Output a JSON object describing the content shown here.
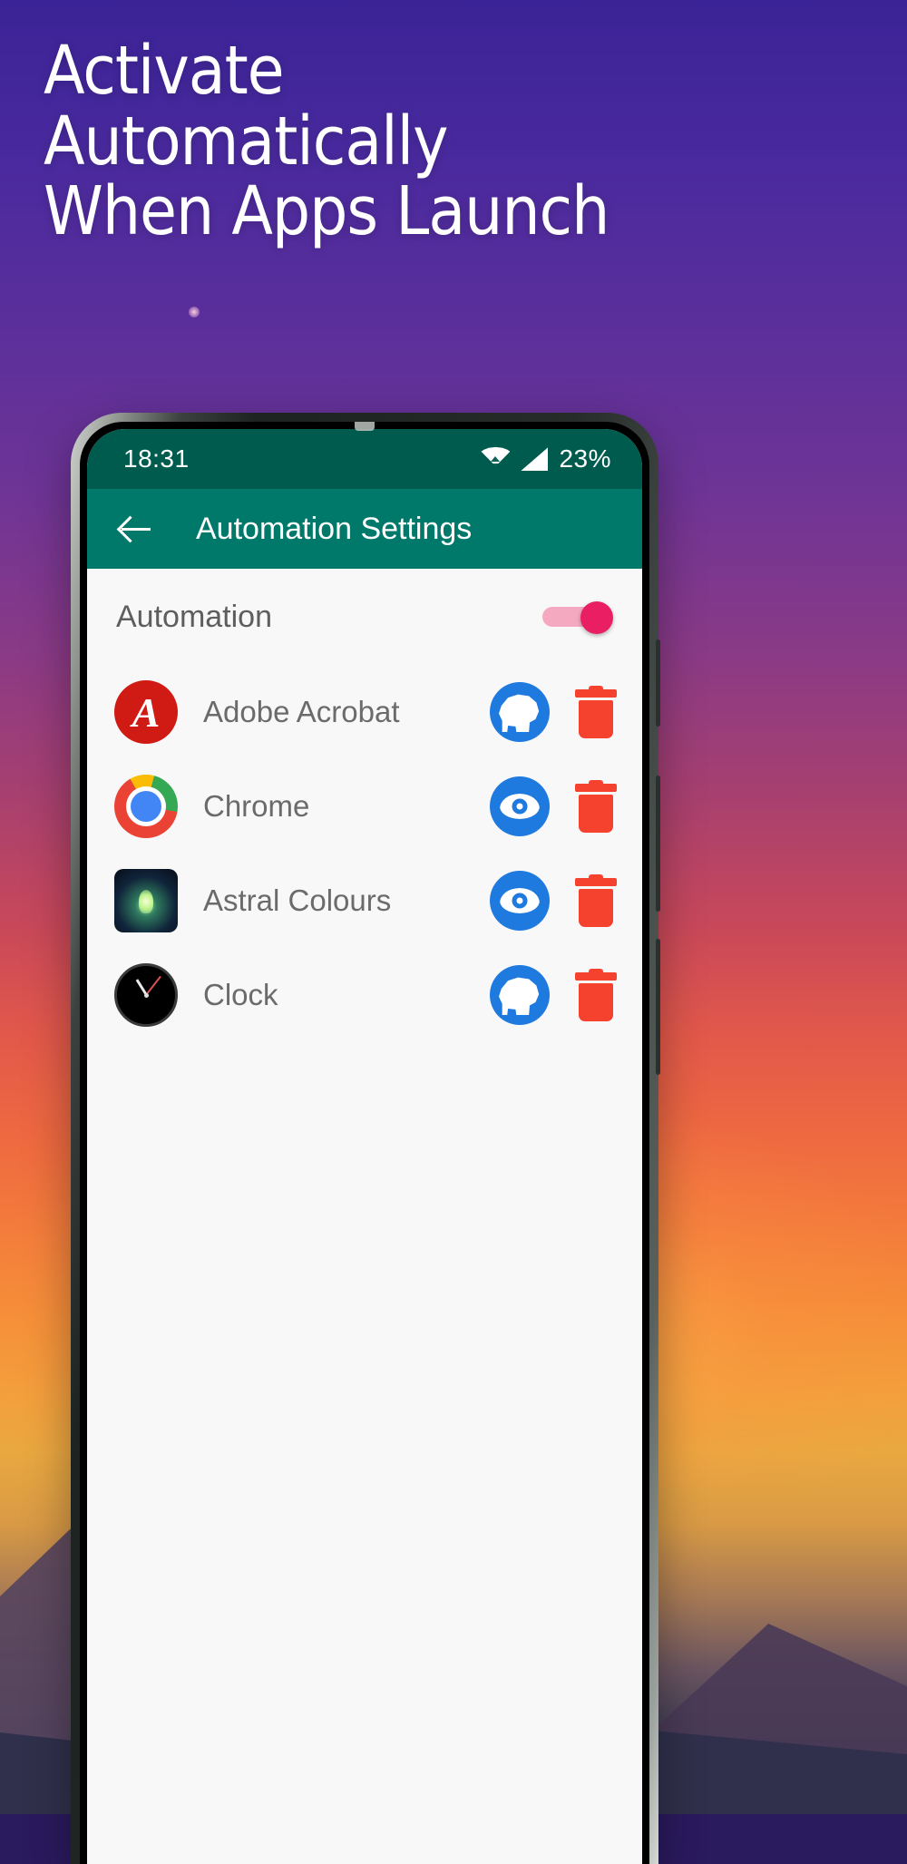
{
  "headline": {
    "lines": [
      "Activate",
      "Automatically",
      "When Apps Launch"
    ]
  },
  "colors": {
    "statusbar": "#005b4f",
    "appbar": "#00796b",
    "accent_toggle": "#e91e63",
    "action_blue": "#1f7ae0",
    "delete_red": "#f4422e",
    "screen_bg": "#f8f8f8"
  },
  "phone": {
    "statusbar": {
      "time": "18:31",
      "battery": "23%",
      "wifi_icon": "wifi-icon",
      "signal_icon": "cellular-signal-icon"
    },
    "appbar": {
      "back_icon": "back-arrow-icon",
      "title": "Automation Settings"
    },
    "automation": {
      "label": "Automation",
      "toggle_state": "on"
    },
    "apps": [
      {
        "name": "Adobe Acrobat",
        "icon": "adobe-acrobat-icon",
        "action_icon": "brain-head-icon",
        "delete_icon": "trash-icon"
      },
      {
        "name": "Chrome",
        "icon": "chrome-icon",
        "action_icon": "eye-icon",
        "delete_icon": "trash-icon"
      },
      {
        "name": "Astral Colours",
        "icon": "astral-colours-icon",
        "action_icon": "eye-icon",
        "delete_icon": "trash-icon"
      },
      {
        "name": "Clock",
        "icon": "clock-icon",
        "action_icon": "brain-head-icon",
        "delete_icon": "trash-icon"
      }
    ]
  }
}
